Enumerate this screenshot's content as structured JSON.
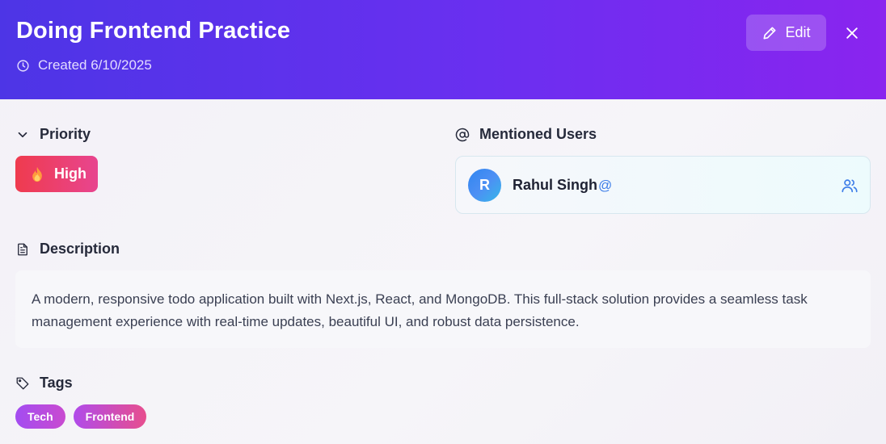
{
  "header": {
    "title": "Doing Frontend Practice",
    "created": "Created 6/10/2025",
    "edit_label": "Edit"
  },
  "priority": {
    "heading": "Priority",
    "value": "High"
  },
  "mentions": {
    "heading": "Mentioned Users",
    "users": [
      {
        "initial": "R",
        "name": "Rahul Singh",
        "handle": "@"
      }
    ]
  },
  "description": {
    "heading": "Description",
    "text": "A modern, responsive todo application built with Next.js, React, and MongoDB. This full-stack solution provides a seamless task management experience with real-time updates, beautiful UI, and robust data persistence."
  },
  "tags": {
    "heading": "Tags",
    "items": [
      "Tech",
      "Frontend"
    ]
  },
  "icons": {
    "created": "clock-icon",
    "edit": "pencil-icon",
    "close": "close-icon",
    "priority": "chevron-down-icon",
    "priority_badge": "fire-icon",
    "mentions": "at-sign-icon",
    "user_card": "users-icon",
    "description": "file-text-icon",
    "tags": "tag-icon"
  },
  "colors": {
    "header_start": "#4d35e6",
    "header_end": "#8a24ef",
    "priority_high": "#ef3b4e",
    "mention_accent": "#3d7de8",
    "tag_gradient_start": "#a24bf0",
    "tag_gradient_end": "#e6508f"
  }
}
